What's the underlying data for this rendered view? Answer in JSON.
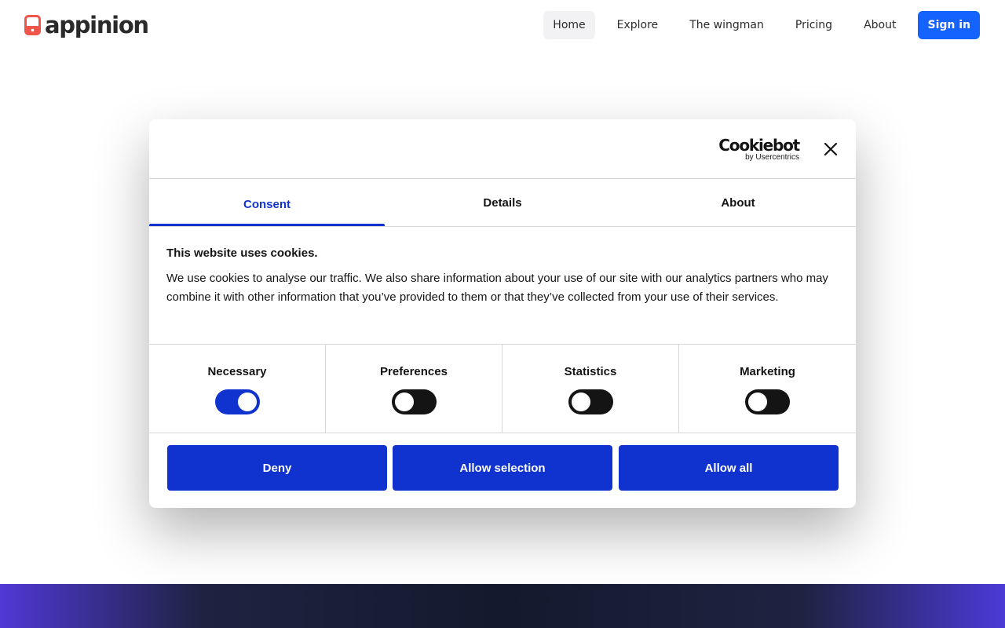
{
  "header": {
    "logo_text": "appinion",
    "nav": [
      "Home",
      "Explore",
      "The wingman",
      "Pricing",
      "About"
    ],
    "active_nav": "Home",
    "signin_label": "Sign in"
  },
  "colors": {
    "accent_blue": "#1463ff",
    "logo_red": "#f0554a",
    "consent_blue": "#1032cf"
  },
  "cookie_dialog": {
    "brand_name": "Cookiebot",
    "brand_sub": "by Usercentrics",
    "close_icon": "close-icon",
    "tabs": [
      "Consent",
      "Details",
      "About"
    ],
    "active_tab": "Consent",
    "title": "This website uses cookies.",
    "body": "We use cookies to analyse our traffic. We also share information about your use of our site with our analytics partners who may combine it with other information that you’ve provided to them or that they’ve collected from your use of their services.",
    "toggles": [
      {
        "label": "Necessary",
        "on": true
      },
      {
        "label": "Preferences",
        "on": false
      },
      {
        "label": "Statistics",
        "on": false
      },
      {
        "label": "Marketing",
        "on": false
      }
    ],
    "buttons": {
      "deny": "Deny",
      "allow_selection": "Allow selection",
      "allow_all": "Allow all"
    }
  }
}
